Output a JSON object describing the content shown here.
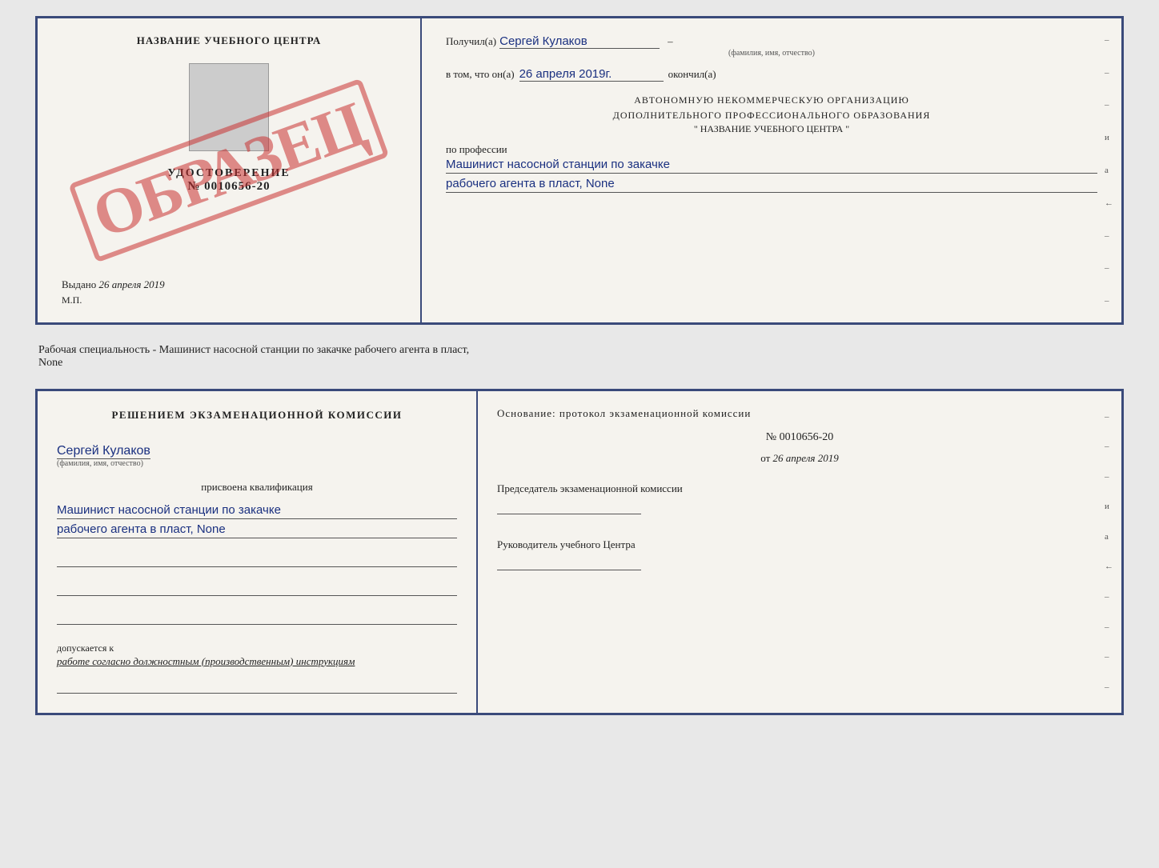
{
  "top_cert": {
    "left": {
      "school_name": "НАЗВАНИЕ УЧЕБНОГО ЦЕНТРА",
      "udostoverenie_title": "УДОСТОВЕРЕНИЕ",
      "udostoverenie_num": "№ 0010656-20",
      "vydano_label": "Выдано",
      "vydano_date": "26 апреля 2019",
      "mp_label": "М.П.",
      "obrazets": "ОБРАЗЕЦ"
    },
    "right": {
      "poluchil_label": "Получил(a)",
      "poluchil_value": "Сергей Кулаков",
      "familiya_hint": "(фамилия, имя, отчество)",
      "vtom_label": "в том, что он(а)",
      "vtom_date": "26 апреля 2019г.",
      "okonchil_label": "окончил(а)",
      "autonomy_line1": "АВТОНОМНУЮ НЕКОММЕРЧЕСКУЮ ОРГАНИЗАЦИЮ",
      "autonomy_line2": "ДОПОЛНИТЕЛЬНОГО ПРОФЕССИОНАЛЬНОГО ОБРАЗОВАНИЯ",
      "school_quotes": "\"  НАЗВАНИЕ УЧЕБНОГО ЦЕНТРА  \"",
      "po_professii_label": "по профессии",
      "professiya_line1": "Машинист насосной станции по закачке",
      "professiya_line2": "рабочего агента в пласт, None",
      "right_marks": [
        "-",
        "-",
        "-",
        "и",
        "а",
        "←",
        "-",
        "-",
        "-"
      ]
    }
  },
  "middle": {
    "text": "Рабочая специальность - Машинист насосной станции по закачке рабочего агента в пласт,",
    "text2": "None"
  },
  "bottom_cert": {
    "left": {
      "komissia_title": "Решением экзаменационной комиссии",
      "name_value": "Сергей Кулаков",
      "familiya_hint": "(фамилия, имя, отчество)",
      "prisvoena_label": "присвоена квалификация",
      "kval_line1": "Машинист насосной станции по закачке",
      "kval_line2": "рабочего агента в пласт, None",
      "dopuskaetsya_label": "допускается к",
      "dopuskaetsya_value": "работе согласно должностным (производственным) инструкциям"
    },
    "right": {
      "osnovaniye_label": "Основание: протокол экзаменационной комиссии",
      "protocol_num": "№ 0010656-20",
      "ot_label": "от",
      "ot_date": "26 апреля 2019",
      "predsedatel_label": "Председатель экзаменационной комиссии",
      "rukovoditel_label": "Руководитель учебного Центра",
      "right_marks": [
        "-",
        "-",
        "-",
        "и",
        "а",
        "←",
        "-",
        "-",
        "-",
        "-"
      ]
    }
  }
}
